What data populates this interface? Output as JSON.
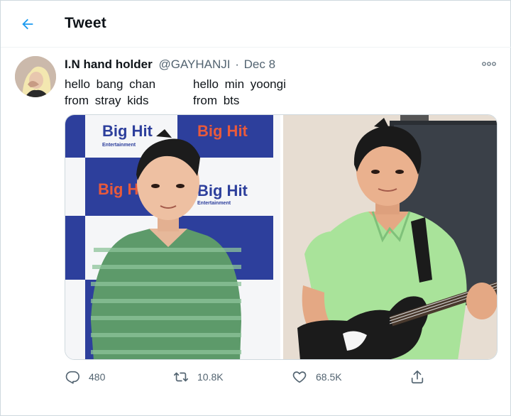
{
  "header": {
    "title": "Tweet",
    "back_icon": "arrow-left-icon"
  },
  "tweet": {
    "display_name": "I.N hand holder",
    "handle": "@GAYHANJI",
    "separator": "·",
    "date": "Dec 8",
    "text_col1": "hello bang chan\nfrom stray kids",
    "text_col2": "hello min yoongi\nfrom bts",
    "more_icon": "more-horizontal-icon"
  },
  "media": {
    "left_logo_lines": [
      "Big Hit",
      "Entertainment"
    ]
  },
  "actions": {
    "reply_count": "480",
    "retweet_count": "10.8K",
    "like_count": "68.5K"
  },
  "colors": {
    "accent": "#1d9bf0",
    "muted": "#536471",
    "text": "#0f1419"
  }
}
